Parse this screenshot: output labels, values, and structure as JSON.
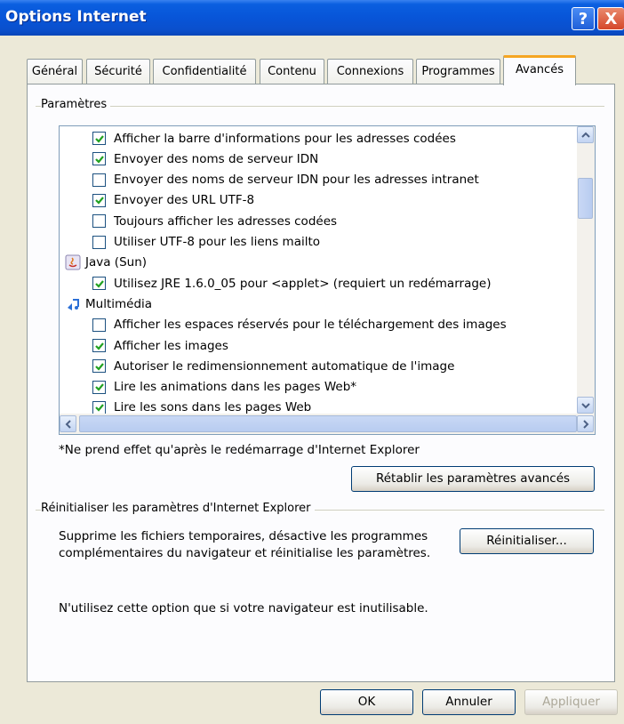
{
  "window": {
    "title": "Options Internet"
  },
  "title_buttons": {
    "help": "?",
    "close": "X"
  },
  "tabs": [
    "Général",
    "Sécurité",
    "Confidentialité",
    "Contenu",
    "Connexions",
    "Programmes",
    "Avancés"
  ],
  "active_tab": "Avancés",
  "settings": {
    "label": "Paramètres",
    "items": [
      {
        "type": "checkbox",
        "checked": true,
        "label": "Afficher la barre d'informations pour les adresses codées"
      },
      {
        "type": "checkbox",
        "checked": true,
        "label": "Envoyer des noms de serveur IDN"
      },
      {
        "type": "checkbox",
        "checked": false,
        "label": "Envoyer des noms de serveur IDN pour les adresses intranet"
      },
      {
        "type": "checkbox",
        "checked": true,
        "label": "Envoyer des URL UTF-8"
      },
      {
        "type": "checkbox",
        "checked": false,
        "label": "Toujours afficher les adresses codées"
      },
      {
        "type": "checkbox",
        "checked": false,
        "label": "Utiliser UTF-8 pour les liens mailto"
      },
      {
        "type": "category",
        "icon": "java-icon",
        "label": "Java (Sun)"
      },
      {
        "type": "checkbox",
        "checked": true,
        "label": "Utilisez JRE 1.6.0_05 pour <applet> (requiert un redémarrage)"
      },
      {
        "type": "category",
        "icon": "multimedia-icon",
        "label": "Multimédia"
      },
      {
        "type": "checkbox",
        "checked": false,
        "label": "Afficher les espaces réservés pour le téléchargement des images"
      },
      {
        "type": "checkbox",
        "checked": true,
        "label": "Afficher les images"
      },
      {
        "type": "checkbox",
        "checked": true,
        "label": "Autoriser le redimensionnement automatique de l'image"
      },
      {
        "type": "checkbox",
        "checked": true,
        "label": "Lire les animations dans les pages Web*"
      },
      {
        "type": "checkbox",
        "checked": true,
        "label": "Lire les sons dans les pages Web"
      }
    ]
  },
  "note": "*Ne prend effet qu'après le redémarrage d'Internet Explorer",
  "restore_button": "Rétablir les paramètres avancés",
  "reset_group": {
    "label": "Réinitialiser les paramètres d'Internet Explorer",
    "description_line1": "Supprime les fichiers temporaires, désactive les programmes",
    "description_line2": "complémentaires du navigateur et réinitialise les paramètres.",
    "reset_button": "Réinitialiser...",
    "warning": "N'utilisez cette option que si votre navigateur est inutilisable."
  },
  "footer": {
    "ok": "OK",
    "cancel": "Annuler",
    "apply": "Appliquer"
  }
}
